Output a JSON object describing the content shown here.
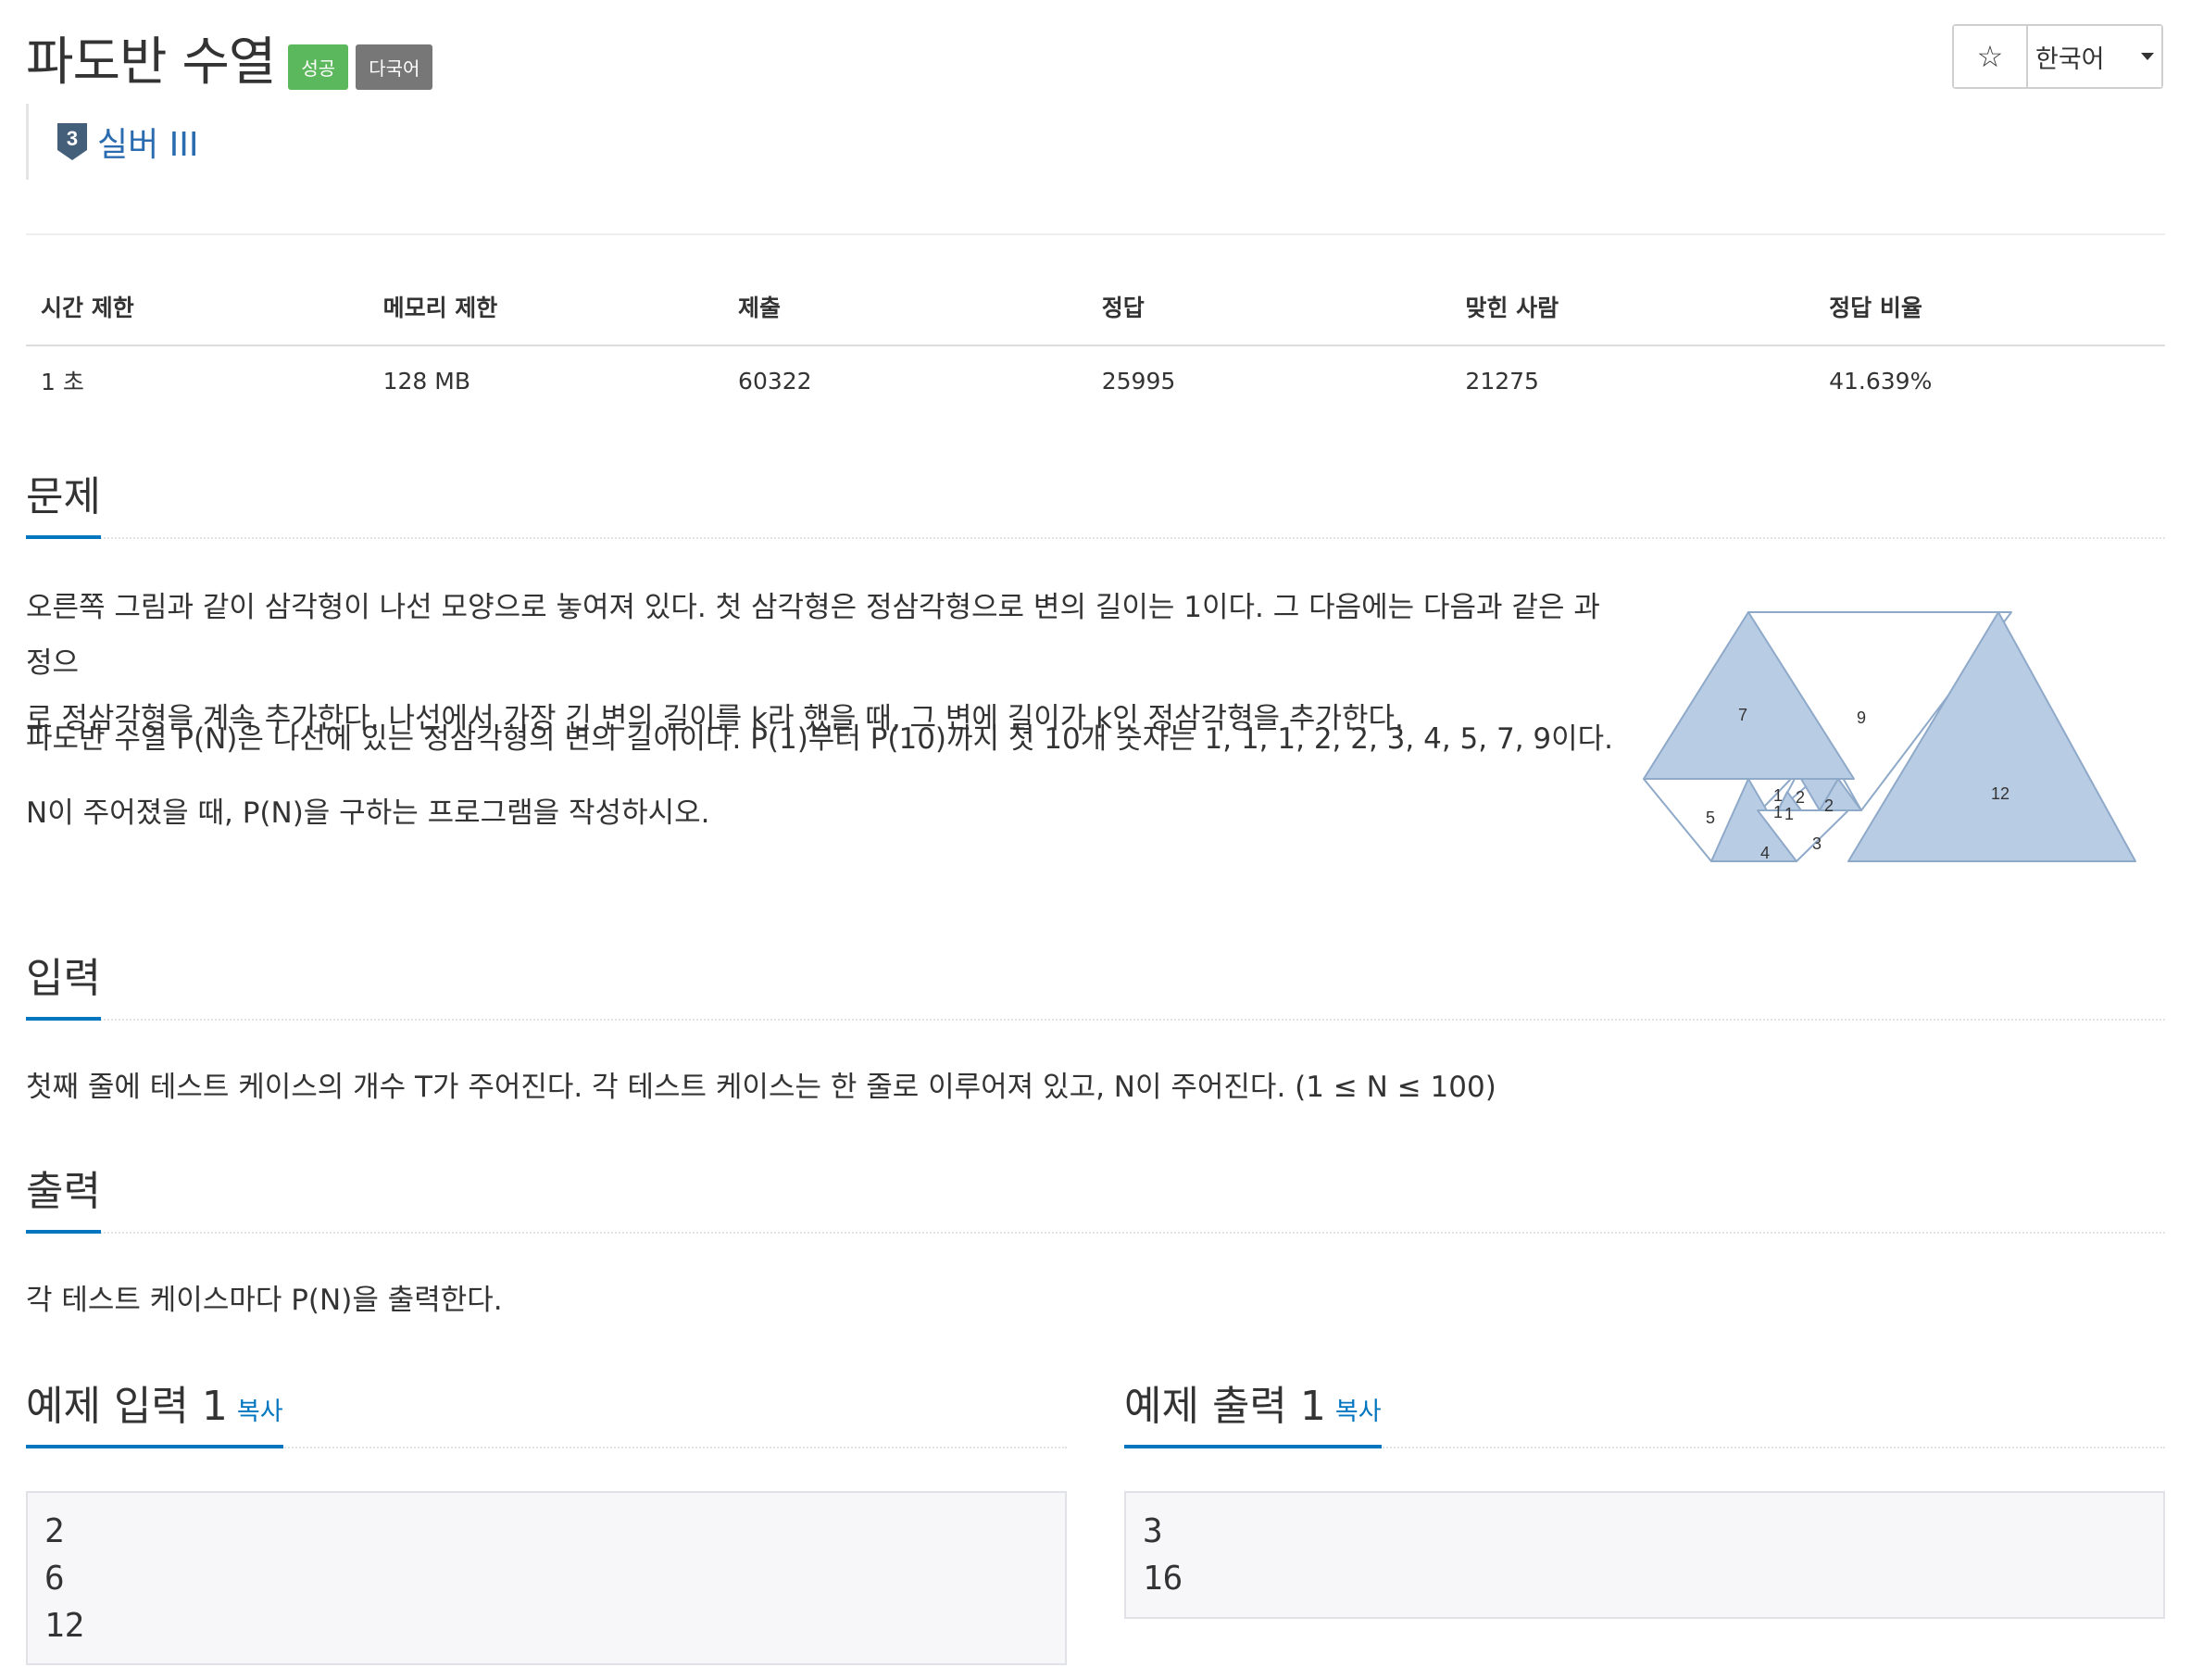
{
  "header": {
    "title": "파도반 수열",
    "badge_success": "성공",
    "badge_multilang": "다국어",
    "tier_number": "3",
    "tier_label": "실버 III",
    "star_icon": "☆",
    "language": "한국어"
  },
  "stats": {
    "headers": [
      "시간 제한",
      "메모리 제한",
      "제출",
      "정답",
      "맞힌 사람",
      "정답 비율"
    ],
    "values": [
      "1 초",
      "128 MB",
      "60322",
      "25995",
      "21275",
      "41.639%"
    ]
  },
  "problem": {
    "heading": "문제",
    "paragraphs": [
      "오른쪽 그림과 같이 삼각형이 나선 모양으로 놓여져 있다. 첫 삼각형은 정삼각형으로 변의 길이는 1이다. 그 다음에는 다음과 같은 과정으",
      "로 정삼각형을 계속 추가한다. 나선에서 가장 긴 변의 길이를 k라 했을 때, 그 변에 길이가 k인 정삼각형을 추가한다.",
      "파도반 수열 P(N)은 나선에 있는 정삼각형의 변의 길이이다. P(1)부터 P(10)까지 첫 10개 숫자는 1, 1, 1, 2, 2, 3, 4, 5, 7, 9이다.",
      "N이 주어졌을 때, P(N)을 구하는 프로그램을 작성하시오."
    ],
    "diagram_labels": [
      "7",
      "9",
      "12",
      "5",
      "1",
      "2",
      "1",
      "1",
      "2",
      "4",
      "3"
    ]
  },
  "input": {
    "heading": "입력",
    "text": "첫째 줄에 테스트 케이스의 개수 T가 주어진다. 각 테스트 케이스는 한 줄로 이루어져 있고, N이 주어진다. (1 ≤ N ≤ 100)"
  },
  "output": {
    "heading": "출력",
    "text": "각 테스트 케이스마다 P(N)을 출력한다."
  },
  "samples": {
    "input_heading": "예제 입력 1",
    "output_heading": "예제 출력 1",
    "copy_label": "복사",
    "input_text": "2\n6\n12",
    "output_text": "3\n16"
  },
  "colors": {
    "accent": "#0076c0",
    "success": "#5cb85c",
    "gray_badge": "#777777",
    "triangle_fill": "#b8cce4",
    "triangle_stroke": "#8fa9c9"
  }
}
